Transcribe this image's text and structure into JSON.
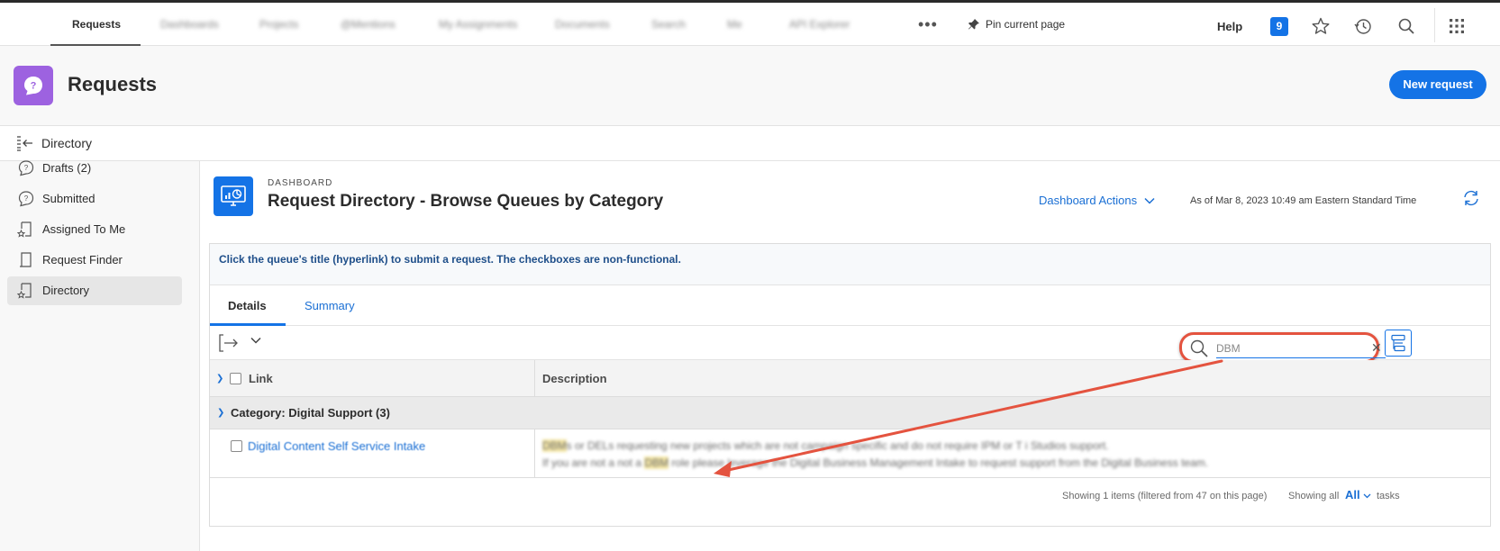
{
  "topnav": {
    "tabs": [
      {
        "label": "Requests"
      },
      {
        "label": "Dashboards"
      },
      {
        "label": "Projects"
      },
      {
        "label": "@Mentions"
      },
      {
        "label": "My Assignments"
      },
      {
        "label": "Documents"
      },
      {
        "label": "Search"
      },
      {
        "label": "Me"
      },
      {
        "label": "API Explorer"
      }
    ],
    "more_label": "•••",
    "pin_label": "Pin current page",
    "help_label": "Help",
    "notification_count": "9"
  },
  "header": {
    "title": "Requests",
    "new_request_label": "New request"
  },
  "directory_bar": {
    "label": "Directory"
  },
  "sidebar": {
    "items": [
      {
        "label": "Drafts (2)"
      },
      {
        "label": "Submitted"
      },
      {
        "label": "Assigned To Me"
      },
      {
        "label": "Request Finder"
      },
      {
        "label": "Directory"
      }
    ],
    "selected_index": 4
  },
  "dashboard": {
    "kicker": "DASHBOARD",
    "title": "Request Directory - Browse Queues by Category",
    "actions_label": "Dashboard Actions",
    "as_of": "As of  Mar 8, 2023 10:49 am Eastern Standard Time",
    "notice": "Click the queue's title (hyperlink) to submit a request. The checkboxes are non-functional."
  },
  "tabs": {
    "details": "Details",
    "summary": "Summary"
  },
  "search": {
    "value": "DBM"
  },
  "table": {
    "columns": [
      "Link",
      "Description"
    ],
    "group_label": "Category: Digital Support (3)",
    "rows": [
      {
        "link": "Digital Content Self Service Intake",
        "desc_line1_hl": "DBM",
        "desc_line1_rest": "s or DELs requesting new projects which are not campaign specific and do not require IPM or T i Studios support.",
        "desc_line2_pre": "If you are not a not a ",
        "desc_line2_hl": "DBM",
        "desc_line2_rest": " role please leverage the Digital Business Management Intake to request support from the Digital Business team."
      }
    ]
  },
  "footer": {
    "showing": "Showing 1 items (filtered from 47 on this page)",
    "showing_all": "Showing all",
    "all": "All",
    "tasks": "tasks"
  },
  "colors": {
    "accent": "#1473e6",
    "app_icon": "#9d62e0",
    "annotation": "#e4533f",
    "highlight": "#f5e7a6"
  }
}
